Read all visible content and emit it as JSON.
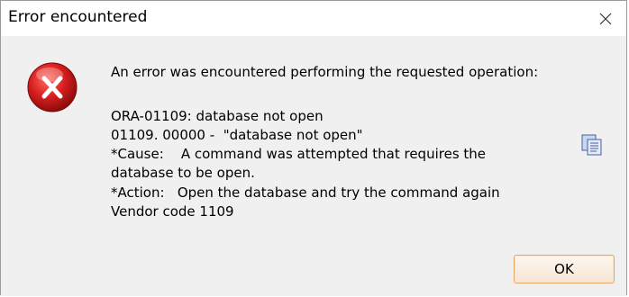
{
  "window": {
    "title": "Error encountered",
    "close_label": "close"
  },
  "message": {
    "heading": "An error was encountered performing the requested operation:",
    "lines": [
      "ORA-01109: database not open",
      "01109. 00000 -  \"database not open\"",
      "*Cause:    A command was attempted that requires the",
      "database to be open.",
      "*Action:   Open the database and try the command again",
      "Vendor code 1109"
    ]
  },
  "buttons": {
    "ok_label": "OK"
  },
  "icons": {
    "error": "error-icon",
    "copy": "copy-icon",
    "close": "close-icon"
  },
  "colors": {
    "error_red": "#d81e1e",
    "ok_border": "#e5a46a",
    "dialog_bg": "#f0f0f0"
  }
}
